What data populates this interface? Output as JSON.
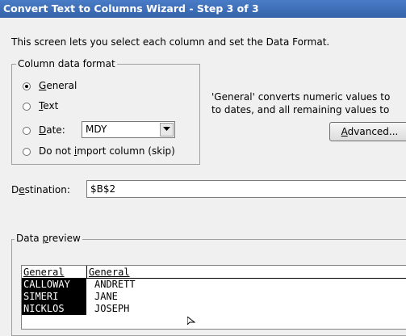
{
  "title": "Convert Text to Columns Wizard - Step 3 of 3",
  "intro": "This screen lets you select each column and set the Data Format.",
  "format_group": {
    "legend": "Column data format",
    "options": [
      {
        "pre": "",
        "u": "G",
        "post": "eneral",
        "selected": true
      },
      {
        "pre": "",
        "u": "T",
        "post": "ext",
        "selected": false
      },
      {
        "pre": "",
        "u": "D",
        "post": "ate:",
        "selected": false
      },
      {
        "pre": "Do not ",
        "u": "i",
        "post": "mport column (skip)",
        "selected": false
      }
    ],
    "date_format": "MDY"
  },
  "hint_line1": "'General' converts numeric values to",
  "hint_line2": "to dates, and all remaining values to",
  "advanced": {
    "u": "A",
    "rest": "dvanced..."
  },
  "destination": {
    "pre": "D",
    "u": "e",
    "post": "stination:",
    "value": "$B$2"
  },
  "preview": {
    "legend_pre": "Data ",
    "legend_u": "p",
    "legend_post": "review",
    "headers": [
      "General",
      "General"
    ],
    "rows": [
      [
        "CALLOWAY",
        "ANDRETT"
      ],
      [
        "SIMERI",
        "JANE"
      ],
      [
        "NICKLOS",
        "JOSEPH"
      ]
    ]
  },
  "colors": {
    "title_bar": "#3a6dbb",
    "dialog_bg": "#f0f0f0",
    "selected_column": "#000000"
  }
}
